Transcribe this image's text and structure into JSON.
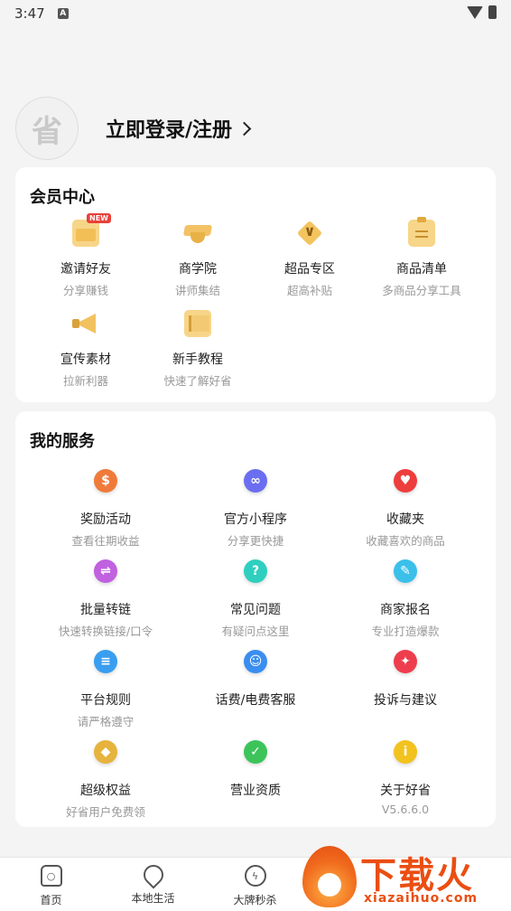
{
  "status_bar": {
    "time": "3:47",
    "notif_icon": "A"
  },
  "login": {
    "avatar_glyph": "省",
    "label": "立即登录/注册"
  },
  "member_center": {
    "title": "会员中心",
    "items": [
      {
        "title": "邀请好友",
        "sub": "分享赚钱",
        "icon": "envelope-icon",
        "badge": "NEW"
      },
      {
        "title": "商学院",
        "sub": "讲师集结",
        "icon": "graduation-cap-icon"
      },
      {
        "title": "超品专区",
        "sub": "超高补贴",
        "icon": "diamond-icon"
      },
      {
        "title": "商品清单",
        "sub": "多商品分享工具",
        "icon": "clipboard-icon"
      },
      {
        "title": "宣传素材",
        "sub": "拉新利器",
        "icon": "megaphone-icon"
      },
      {
        "title": "新手教程",
        "sub": "快速了解好省",
        "icon": "book-icon"
      }
    ]
  },
  "services": {
    "title": "我的服务",
    "items": [
      {
        "title": "奖励活动",
        "sub": "查看往期收益",
        "icon": "money-bag-icon",
        "glyph": "$",
        "color": "#f07a3a"
      },
      {
        "title": "官方小程序",
        "sub": "分享更快捷",
        "icon": "link-icon",
        "glyph": "∞",
        "color": "#6b6ef0"
      },
      {
        "title": "收藏夹",
        "sub": "收藏喜欢的商品",
        "icon": "heart-icon",
        "glyph": "♥",
        "color": "#ee3d3d"
      },
      {
        "title": "批量转链",
        "sub": "快速转换链接/口令",
        "icon": "swap-icon",
        "glyph": "⇌",
        "color": "#c061e0"
      },
      {
        "title": "常见问题",
        "sub": "有疑问点这里",
        "icon": "question-icon",
        "glyph": "?",
        "color": "#2fcfbf"
      },
      {
        "title": "商家报名",
        "sub": "专业打造爆款",
        "icon": "pencil-icon",
        "glyph": "✎",
        "color": "#3bc0ea"
      },
      {
        "title": "平台规则",
        "sub": "请严格遵守",
        "icon": "rules-doc-icon",
        "glyph": "≡",
        "color": "#3a9ef0"
      },
      {
        "title": "话费/电费客服",
        "sub": "",
        "icon": "customer-service-icon",
        "glyph": "☺",
        "color": "#3a8ef0"
      },
      {
        "title": "投诉与建议",
        "sub": "",
        "icon": "lightbulb-icon",
        "glyph": "✦",
        "color": "#ee3d4d"
      },
      {
        "title": "超级权益",
        "sub": "好省用户免费领",
        "icon": "gem-badge-icon",
        "glyph": "◆",
        "color": "#e6b43d"
      },
      {
        "title": "营业资质",
        "sub": "",
        "icon": "verified-icon",
        "glyph": "✓",
        "color": "#3cc45a"
      },
      {
        "title": "关于好省",
        "sub": "V5.6.6.0",
        "icon": "info-icon",
        "glyph": "i",
        "color": "#f2c21f"
      }
    ]
  },
  "bottom_nav": [
    {
      "label": "首页",
      "icon": "home-icon"
    },
    {
      "label": "本地生活",
      "icon": "location-pin-icon"
    },
    {
      "label": "大牌秒杀",
      "icon": "lightning-icon"
    }
  ],
  "watermark": {
    "text": "下载火",
    "url": "xiazaihuo.com"
  }
}
